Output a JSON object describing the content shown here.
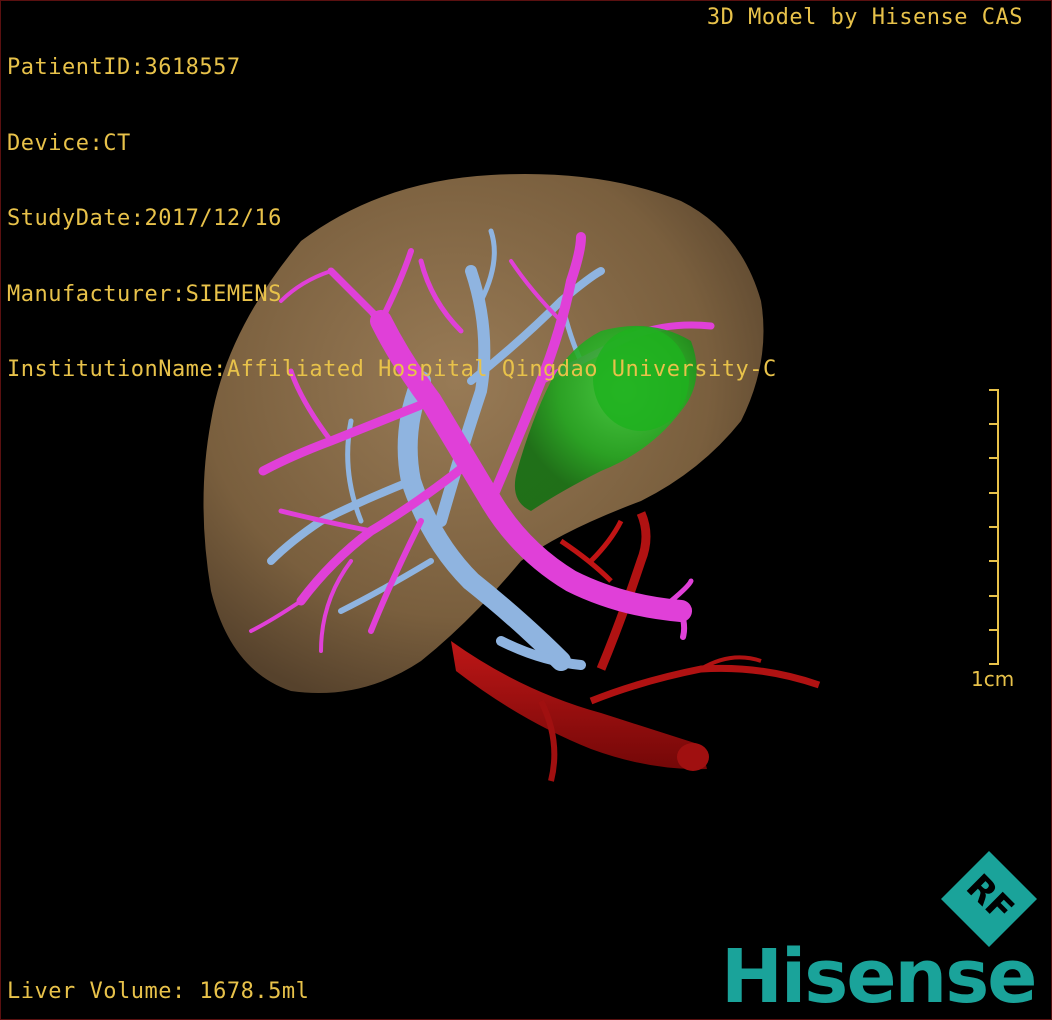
{
  "overlay": {
    "patient_id": "PatientID:3618557",
    "device": "Device:CT",
    "study_date": "StudyDate:2017/12/16",
    "manufacturer": "Manufacturer:SIEMENS",
    "institution": "InstitutionName:Affiliated Hospital Qingdao University-C",
    "title": "3D Model by Hisense CAS",
    "liver_volume": "Liver Volume: 1678.5ml"
  },
  "scale_bar": {
    "label": "1cm"
  },
  "logo": {
    "brand": "Hisense",
    "badge": "RF",
    "brand_color": "#1aa39a"
  },
  "colors": {
    "overlay_text": "#e8c24a",
    "liver": "#8a6a44",
    "hepatic_vein": "#e040d8",
    "portal_vein": "#8fb4e0",
    "gallbladder": "#20a020",
    "artery": "#b01010"
  }
}
